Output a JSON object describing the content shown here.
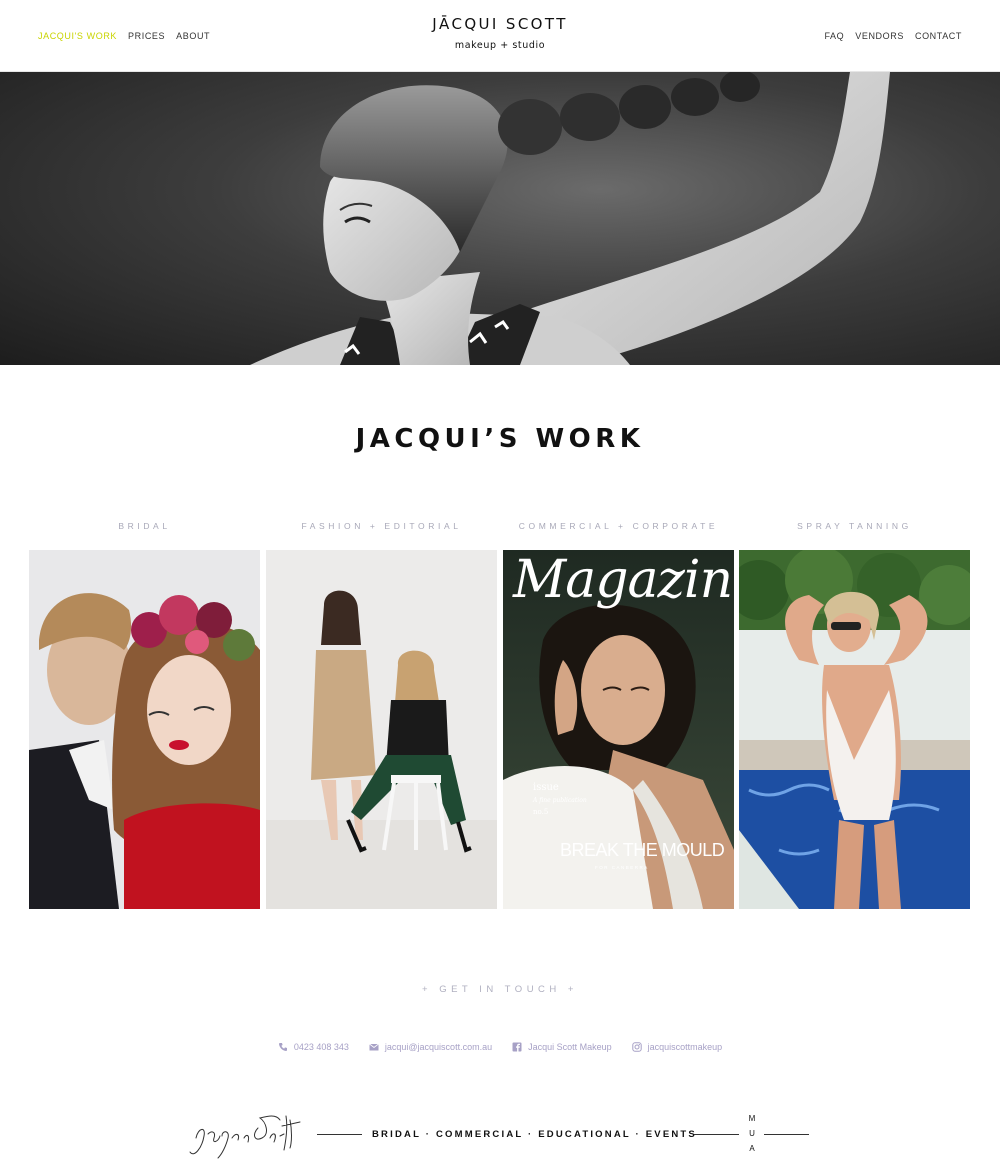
{
  "nav": {
    "left": [
      "JACQUI'S WORK",
      "PRICES",
      "ABOUT"
    ],
    "right": [
      "FAQ",
      "VENDORS",
      "CONTACT"
    ]
  },
  "brand": {
    "name": "JĀCQUI SCOTT",
    "tagline": "makeup + studio"
  },
  "section_title": "JACQUI’S WORK",
  "categories": [
    "BRIDAL",
    "FASHION + EDITORIAL",
    "COMMERCIAL + CORPORATE",
    "SPRAY TANNING"
  ],
  "magazine": {
    "title": "Magazine",
    "issue": "issue",
    "issue_sub": "A fine publication",
    "issue_no": "no.5",
    "headline": "BREAK THE MOULD",
    "subline": "FOR CANBERRA"
  },
  "contact": {
    "heading": "+ GET IN TOUCH +",
    "phone": "0423 408 343",
    "email": "jacqui@jacquiscott.com.au",
    "facebook": "Jacqui Scott Makeup",
    "instagram": "jacquiscottmakeup"
  },
  "footer": {
    "services": "BRIDAL · COMMERCIAL · EDUCATIONAL · EVENTS",
    "mua": [
      "M",
      "U",
      "A"
    ]
  },
  "colors": {
    "active_nav": "#c9d400",
    "contact_text": "#a7a1c6",
    "category_text": "#a8a8b8"
  },
  "icons": {
    "phone": "phone-icon",
    "email": "envelope-icon",
    "facebook": "facebook-icon",
    "instagram": "instagram-icon"
  }
}
